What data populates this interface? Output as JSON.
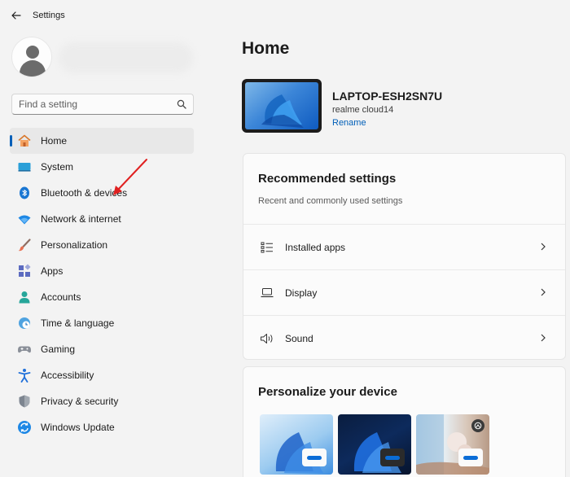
{
  "titlebar": {
    "title": "Settings"
  },
  "search": {
    "placeholder": "Find a setting"
  },
  "sidebar": {
    "items": [
      {
        "label": "Home",
        "icon": "home-icon"
      },
      {
        "label": "System",
        "icon": "system-icon"
      },
      {
        "label": "Bluetooth & devices",
        "icon": "bluetooth-icon"
      },
      {
        "label": "Network & internet",
        "icon": "wifi-icon"
      },
      {
        "label": "Personalization",
        "icon": "brush-icon"
      },
      {
        "label": "Apps",
        "icon": "apps-icon"
      },
      {
        "label": "Accounts",
        "icon": "accounts-icon"
      },
      {
        "label": "Time & language",
        "icon": "globe-clock-icon"
      },
      {
        "label": "Gaming",
        "icon": "gamepad-icon"
      },
      {
        "label": "Accessibility",
        "icon": "accessibility-icon"
      },
      {
        "label": "Privacy & security",
        "icon": "shield-icon"
      },
      {
        "label": "Windows Update",
        "icon": "sync-icon"
      }
    ]
  },
  "main": {
    "page_title": "Home",
    "device": {
      "name": "LAPTOP-ESH2SN7U",
      "model": "realme cloud14",
      "rename_label": "Rename"
    },
    "recommended": {
      "title": "Recommended settings",
      "subtitle": "Recent and commonly used settings",
      "rows": [
        {
          "label": "Installed apps",
          "icon": "list-icon"
        },
        {
          "label": "Display",
          "icon": "laptop-icon"
        },
        {
          "label": "Sound",
          "icon": "speaker-icon"
        }
      ]
    },
    "personalize": {
      "title": "Personalize your device"
    }
  },
  "colors": {
    "accent": "#005fb8",
    "annotation_arrow": "#e02020"
  }
}
